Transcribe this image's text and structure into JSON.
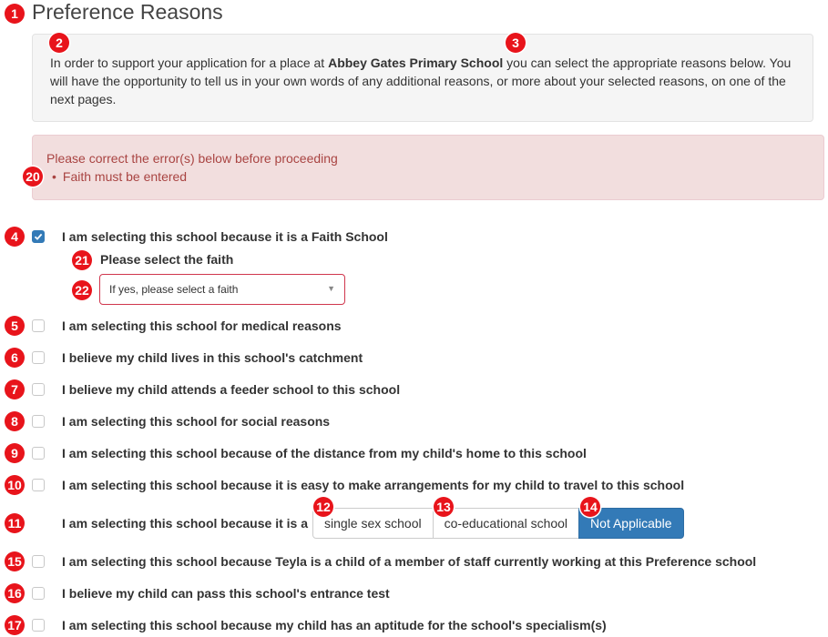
{
  "page": {
    "title": "Preference Reasons",
    "intro_prefix": "In order to support your application for a place at ",
    "school_name": "Abbey Gates Primary School",
    "intro_suffix": " you can select the appropriate reasons below. You will have the opportunity to tell us in your own words of any additional reasons, or more about your selected reasons, on one of the next pages."
  },
  "alert": {
    "heading": "Please correct the error(s) below before proceeding",
    "errors": [
      "Faith must be entered"
    ]
  },
  "reasons": [
    {
      "badge": "4",
      "label": "I am selecting this school because it is a Faith School",
      "checked": true
    },
    {
      "badge": "5",
      "label": "I am selecting this school for medical reasons",
      "checked": false
    },
    {
      "badge": "6",
      "label": "I believe my child lives in this school's catchment",
      "checked": false
    },
    {
      "badge": "7",
      "label": "I believe my child attends a feeder school to this school",
      "checked": false
    },
    {
      "badge": "8",
      "label": "I am selecting this school for social reasons",
      "checked": false
    },
    {
      "badge": "9",
      "label": "I am selecting this school because of the distance from my child's home to this school",
      "checked": false
    },
    {
      "badge": "10",
      "label": "I am selecting this school because it is easy to make arrangements for my child to travel to this school",
      "checked": false
    },
    {
      "badge": "15",
      "label": "I am selecting this school because Teyla is a child of a member of staff currently working at this Preference school",
      "checked": false
    },
    {
      "badge": "16",
      "label": "I believe my child can pass this school's entrance test",
      "checked": false
    },
    {
      "badge": "17",
      "label": "I am selecting this school because my child has an aptitude for the school's specialism(s)",
      "checked": false
    }
  ],
  "faith": {
    "label": "Please select the faith",
    "placeholder": "If yes, please select a faith"
  },
  "school_type": {
    "label": "I am selecting this school because it is a",
    "options": [
      "single sex school",
      "co-educational school",
      "Not Applicable"
    ],
    "selected": "Not Applicable"
  },
  "badges": {
    "title": "1",
    "intro": "2",
    "school_name": "3",
    "school_type_row": "11",
    "opt_single": "12",
    "opt_coed": "13",
    "opt_na": "14",
    "error": "20",
    "faith_label": "21",
    "faith_select": "22"
  },
  "colors": {
    "accent": "#337ab7",
    "error_bg": "#f2dede",
    "error_text": "#a94442",
    "badge": "#e8141b"
  }
}
